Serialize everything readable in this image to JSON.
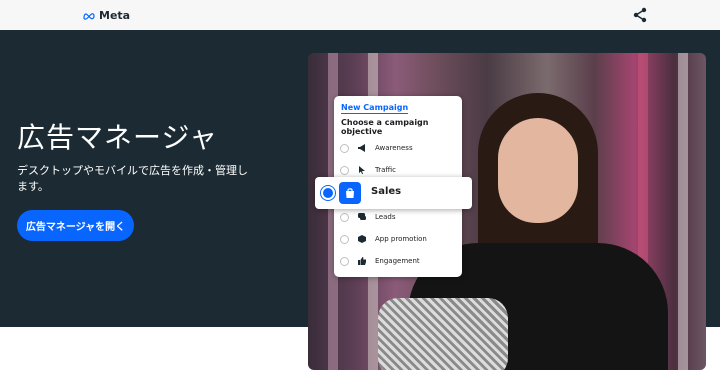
{
  "topbar": {
    "brand": "Meta",
    "icons": [
      "meta-logo-icon",
      "share-icon"
    ]
  },
  "hero": {
    "title": "広告マネージャ",
    "subtitle": "デスクトップやモバイルで広告を作成・管理します。",
    "cta_label": "広告マネージャを開く"
  },
  "campaign_card": {
    "tab_label": "New Campaign",
    "heading": "Choose a campaign objective",
    "options": [
      {
        "label": "Awareness",
        "icon": "megaphone-icon",
        "selected": false
      },
      {
        "label": "Traffic",
        "icon": "cursor-icon",
        "selected": false
      },
      {
        "label": "Sales",
        "icon": "shopping-bag-icon",
        "selected": true
      },
      {
        "label": "Leads",
        "icon": "chat-icon",
        "selected": false
      },
      {
        "label": "App promotion",
        "icon": "box-icon",
        "selected": false
      },
      {
        "label": "Engagement",
        "icon": "thumbs-up-icon",
        "selected": false
      }
    ]
  },
  "colors": {
    "hero_bg": "#1c2b33",
    "accent": "#0866ff",
    "topbar_bg": "#f7f7f7"
  }
}
